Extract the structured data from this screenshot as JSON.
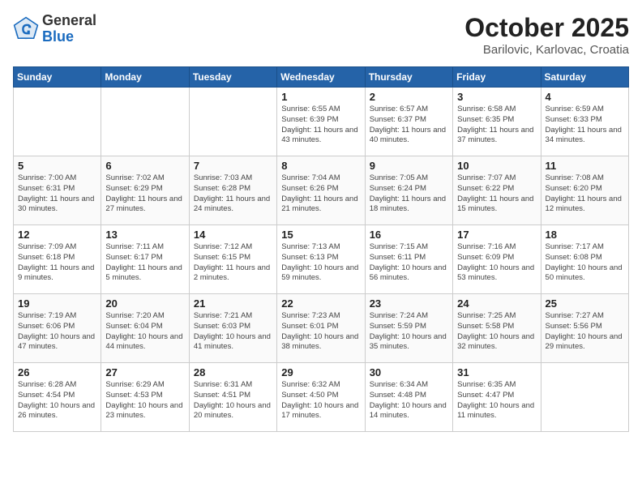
{
  "header": {
    "logo_general": "General",
    "logo_blue": "Blue",
    "month_year": "October 2025",
    "location": "Barilovic, Karlovac, Croatia"
  },
  "calendar": {
    "days_of_week": [
      "Sunday",
      "Monday",
      "Tuesday",
      "Wednesday",
      "Thursday",
      "Friday",
      "Saturday"
    ],
    "weeks": [
      [
        {
          "day": "",
          "info": ""
        },
        {
          "day": "",
          "info": ""
        },
        {
          "day": "",
          "info": ""
        },
        {
          "day": "1",
          "info": "Sunrise: 6:55 AM\nSunset: 6:39 PM\nDaylight: 11 hours\nand 43 minutes."
        },
        {
          "day": "2",
          "info": "Sunrise: 6:57 AM\nSunset: 6:37 PM\nDaylight: 11 hours\nand 40 minutes."
        },
        {
          "day": "3",
          "info": "Sunrise: 6:58 AM\nSunset: 6:35 PM\nDaylight: 11 hours\nand 37 minutes."
        },
        {
          "day": "4",
          "info": "Sunrise: 6:59 AM\nSunset: 6:33 PM\nDaylight: 11 hours\nand 34 minutes."
        }
      ],
      [
        {
          "day": "5",
          "info": "Sunrise: 7:00 AM\nSunset: 6:31 PM\nDaylight: 11 hours\nand 30 minutes."
        },
        {
          "day": "6",
          "info": "Sunrise: 7:02 AM\nSunset: 6:29 PM\nDaylight: 11 hours\nand 27 minutes."
        },
        {
          "day": "7",
          "info": "Sunrise: 7:03 AM\nSunset: 6:28 PM\nDaylight: 11 hours\nand 24 minutes."
        },
        {
          "day": "8",
          "info": "Sunrise: 7:04 AM\nSunset: 6:26 PM\nDaylight: 11 hours\nand 21 minutes."
        },
        {
          "day": "9",
          "info": "Sunrise: 7:05 AM\nSunset: 6:24 PM\nDaylight: 11 hours\nand 18 minutes."
        },
        {
          "day": "10",
          "info": "Sunrise: 7:07 AM\nSunset: 6:22 PM\nDaylight: 11 hours\nand 15 minutes."
        },
        {
          "day": "11",
          "info": "Sunrise: 7:08 AM\nSunset: 6:20 PM\nDaylight: 11 hours\nand 12 minutes."
        }
      ],
      [
        {
          "day": "12",
          "info": "Sunrise: 7:09 AM\nSunset: 6:18 PM\nDaylight: 11 hours\nand 9 minutes."
        },
        {
          "day": "13",
          "info": "Sunrise: 7:11 AM\nSunset: 6:17 PM\nDaylight: 11 hours\nand 5 minutes."
        },
        {
          "day": "14",
          "info": "Sunrise: 7:12 AM\nSunset: 6:15 PM\nDaylight: 11 hours\nand 2 minutes."
        },
        {
          "day": "15",
          "info": "Sunrise: 7:13 AM\nSunset: 6:13 PM\nDaylight: 10 hours\nand 59 minutes."
        },
        {
          "day": "16",
          "info": "Sunrise: 7:15 AM\nSunset: 6:11 PM\nDaylight: 10 hours\nand 56 minutes."
        },
        {
          "day": "17",
          "info": "Sunrise: 7:16 AM\nSunset: 6:09 PM\nDaylight: 10 hours\nand 53 minutes."
        },
        {
          "day": "18",
          "info": "Sunrise: 7:17 AM\nSunset: 6:08 PM\nDaylight: 10 hours\nand 50 minutes."
        }
      ],
      [
        {
          "day": "19",
          "info": "Sunrise: 7:19 AM\nSunset: 6:06 PM\nDaylight: 10 hours\nand 47 minutes."
        },
        {
          "day": "20",
          "info": "Sunrise: 7:20 AM\nSunset: 6:04 PM\nDaylight: 10 hours\nand 44 minutes."
        },
        {
          "day": "21",
          "info": "Sunrise: 7:21 AM\nSunset: 6:03 PM\nDaylight: 10 hours\nand 41 minutes."
        },
        {
          "day": "22",
          "info": "Sunrise: 7:23 AM\nSunset: 6:01 PM\nDaylight: 10 hours\nand 38 minutes."
        },
        {
          "day": "23",
          "info": "Sunrise: 7:24 AM\nSunset: 5:59 PM\nDaylight: 10 hours\nand 35 minutes."
        },
        {
          "day": "24",
          "info": "Sunrise: 7:25 AM\nSunset: 5:58 PM\nDaylight: 10 hours\nand 32 minutes."
        },
        {
          "day": "25",
          "info": "Sunrise: 7:27 AM\nSunset: 5:56 PM\nDaylight: 10 hours\nand 29 minutes."
        }
      ],
      [
        {
          "day": "26",
          "info": "Sunrise: 6:28 AM\nSunset: 4:54 PM\nDaylight: 10 hours\nand 26 minutes."
        },
        {
          "day": "27",
          "info": "Sunrise: 6:29 AM\nSunset: 4:53 PM\nDaylight: 10 hours\nand 23 minutes."
        },
        {
          "day": "28",
          "info": "Sunrise: 6:31 AM\nSunset: 4:51 PM\nDaylight: 10 hours\nand 20 minutes."
        },
        {
          "day": "29",
          "info": "Sunrise: 6:32 AM\nSunset: 4:50 PM\nDaylight: 10 hours\nand 17 minutes."
        },
        {
          "day": "30",
          "info": "Sunrise: 6:34 AM\nSunset: 4:48 PM\nDaylight: 10 hours\nand 14 minutes."
        },
        {
          "day": "31",
          "info": "Sunrise: 6:35 AM\nSunset: 4:47 PM\nDaylight: 10 hours\nand 11 minutes."
        },
        {
          "day": "",
          "info": ""
        }
      ]
    ]
  }
}
